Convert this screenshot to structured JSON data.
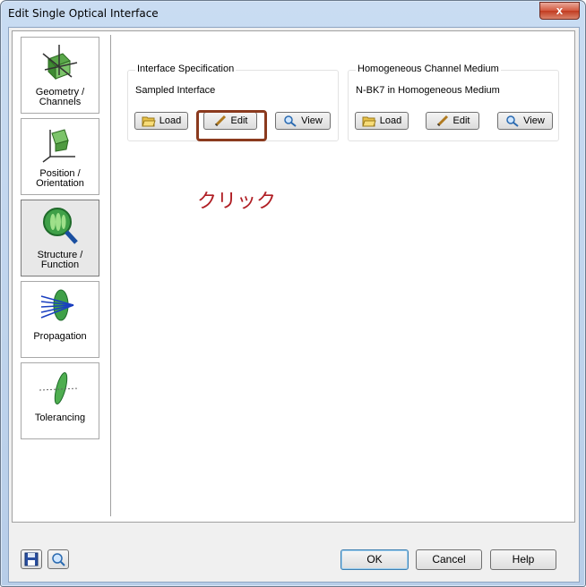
{
  "window": {
    "title": "Edit Single Optical Interface",
    "close_symbol": "x"
  },
  "nav": {
    "items": [
      {
        "label": "Geometry /\nChannels",
        "icon": "geometry-icon"
      },
      {
        "label": "Position /\nOrientation",
        "icon": "position-icon"
      },
      {
        "label": "Structure /\nFunction",
        "icon": "structure-icon",
        "active": true
      },
      {
        "label": "Propagation",
        "icon": "propagation-icon"
      },
      {
        "label": "Tolerancing",
        "icon": "tolerancing-icon"
      }
    ]
  },
  "interface_spec": {
    "title": "Interface Specification",
    "value": "Sampled Interface",
    "load_label": "Load",
    "edit_label": "Edit",
    "view_label": "View"
  },
  "channel_medium": {
    "title": "Homogeneous Channel Medium",
    "value": "N-BK7 in Homogeneous Medium",
    "load_label": "Load",
    "edit_label": "Edit",
    "view_label": "View"
  },
  "annotation": {
    "text": "クリック",
    "color": "#b01e24"
  },
  "footer": {
    "ok_label": "OK",
    "cancel_label": "Cancel",
    "help_label": "Help"
  }
}
